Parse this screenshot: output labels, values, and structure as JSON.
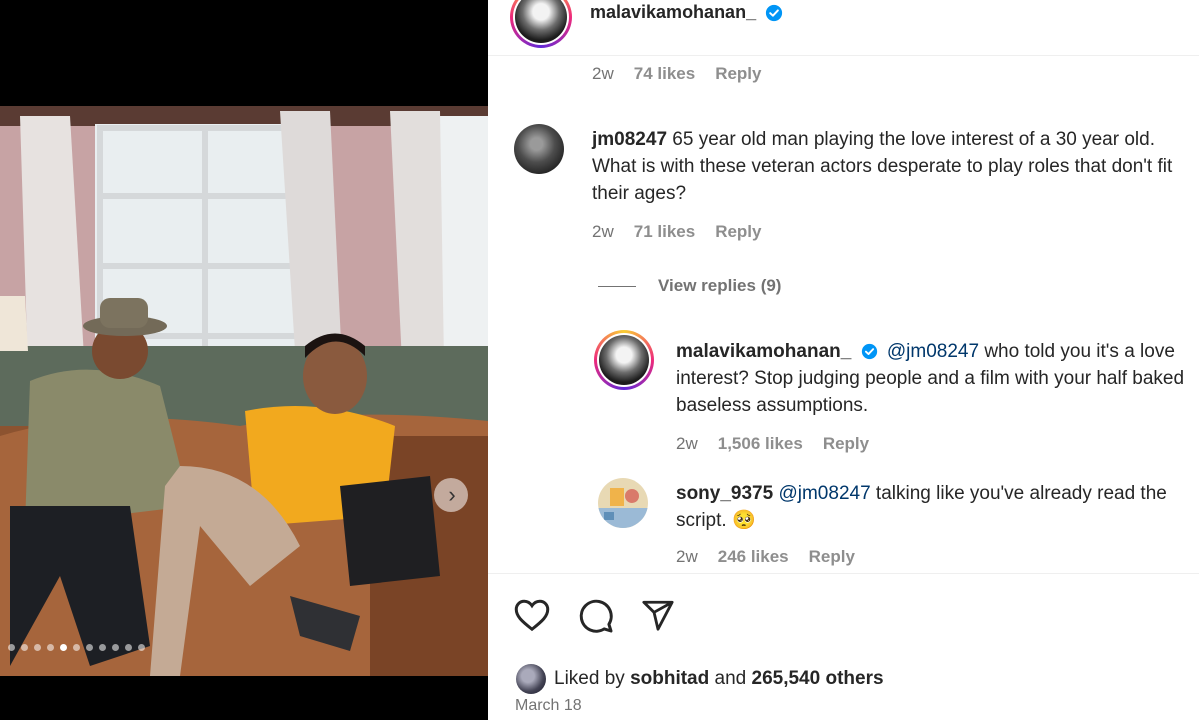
{
  "header": {
    "username": "malavikamohanan_"
  },
  "first_meta": {
    "time": "2w",
    "likes": "74 likes",
    "reply": "Reply"
  },
  "comments": [
    {
      "username": "jm08247",
      "text": "65 year old man playing the love interest of a 30 year old. What is with these veteran actors desperate to play roles that don't fit their ages?",
      "time": "2w",
      "likes": "71 likes",
      "reply": "Reply"
    }
  ],
  "view_replies": "View replies (9)",
  "replies": [
    {
      "username": "malavikamohanan_",
      "mention": "@jm08247",
      "text": "who told you it's a love interest? Stop judging people and a film with your half baked baseless assumptions.",
      "time": "2w",
      "likes": "1,506 likes",
      "reply": "Reply"
    },
    {
      "username": "sony_9375",
      "mention": "@jm08247",
      "text": "talking like you've already read the script. 🥺",
      "time": "2w",
      "likes": "246 likes",
      "reply": "Reply"
    }
  ],
  "footer": {
    "liked_prefix": "Liked by",
    "liked_user": "sobhitad",
    "liked_and": "and",
    "liked_others": "265,540 others",
    "date": "March 18"
  },
  "carousel": {
    "total_slides": 11,
    "active_slide": 5
  },
  "icons": [
    "heart-icon",
    "comment-icon",
    "share-icon",
    "verified-icon",
    "chevron-right-icon"
  ],
  "colors": {
    "verified": "#0095f6",
    "mention": "#00376b",
    "muted": "#737373"
  }
}
